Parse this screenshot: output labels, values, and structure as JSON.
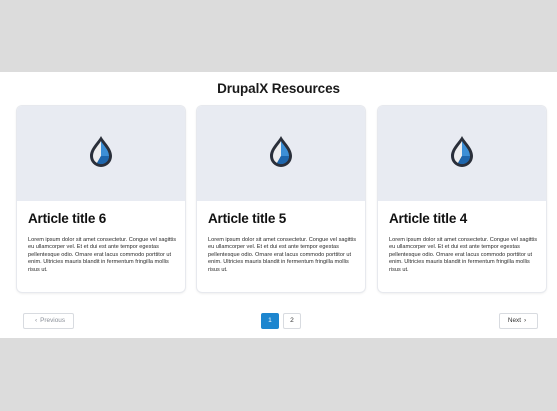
{
  "page": {
    "heading": "DrupalX Resources"
  },
  "articles": [
    {
      "title": "Article title 6",
      "body": "Lorem ipsum dolor sit amet consectetur. Congue vel sagittis eu ullamcorper vel. Et et dui est ante tempor egestas pellentesque odio. Ornare erat lacus commodo porttitor ut enim. Ultricies mauris blandit in fermentum fringilla mollis risus ut.",
      "image_icon": "drupal-drop-logo-icon"
    },
    {
      "title": "Article title 5",
      "body": "Lorem ipsum dolor sit amet consectetur. Congue vel sagittis eu ullamcorper vel. Et et dui est ante tempor egestas pellentesque odio. Ornare erat lacus commodo porttitor ut enim. Ultricies mauris blandit in fermentum fringilla mollis risus ut.",
      "image_icon": "drupal-drop-logo-icon"
    },
    {
      "title": "Article title 4",
      "body": "Lorem ipsum dolor sit amet consectetur. Congue vel sagittis eu ullamcorper vel. Et et dui est ante tempor egestas pellentesque odio. Ornare erat lacus commodo porttitor ut enim. Ultricies mauris blandit in fermentum fringilla mollis risus ut.",
      "image_icon": "drupal-drop-logo-icon"
    }
  ],
  "pagination": {
    "previous_label": "Previous",
    "next_label": "Next",
    "prev_icon": "chevron-left-icon",
    "next_icon": "chevron-right-icon",
    "pages": [
      "1",
      "2"
    ],
    "current_page": "1"
  },
  "colors": {
    "accent": "#1d86cf",
    "card_media_bg": "#e8ebf2",
    "page_bg": "#dcdcdc"
  }
}
